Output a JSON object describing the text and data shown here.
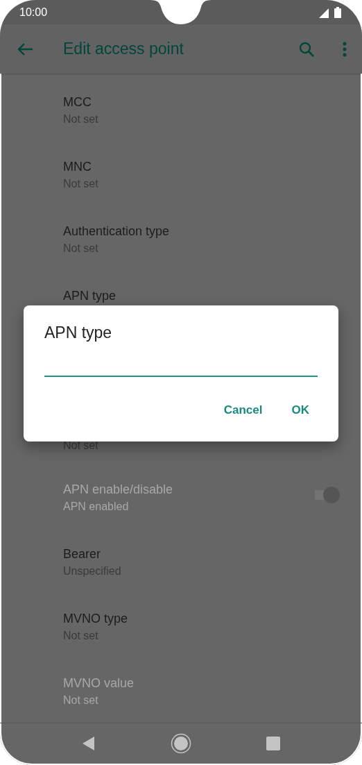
{
  "status_bar": {
    "time": "10:00"
  },
  "app_bar": {
    "title": "Edit access point"
  },
  "items": [
    {
      "kind": "text",
      "title": "MCC",
      "subtitle": "Not set",
      "disabled": false
    },
    {
      "kind": "text",
      "title": "MNC",
      "subtitle": "Not set",
      "disabled": false
    },
    {
      "kind": "text",
      "title": "Authentication type",
      "subtitle": "Not set",
      "disabled": false
    },
    {
      "kind": "title_only",
      "title": "APN type",
      "disabled": false
    },
    {
      "kind": "subtitle_only",
      "subtitle": "Not set",
      "disabled": false
    },
    {
      "kind": "switch",
      "title": "APN enable/disable",
      "subtitle": "APN enabled",
      "disabled": true,
      "on": true
    },
    {
      "kind": "text",
      "title": "Bearer",
      "subtitle": "Unspecified",
      "disabled": false
    },
    {
      "kind": "text",
      "title": "MVNO type",
      "subtitle": "Not set",
      "disabled": false
    },
    {
      "kind": "text",
      "title": "MVNO value",
      "subtitle": "Not set",
      "disabled": true
    }
  ],
  "dialog": {
    "title": "APN type",
    "buttons": [
      "Cancel",
      "OK"
    ]
  }
}
